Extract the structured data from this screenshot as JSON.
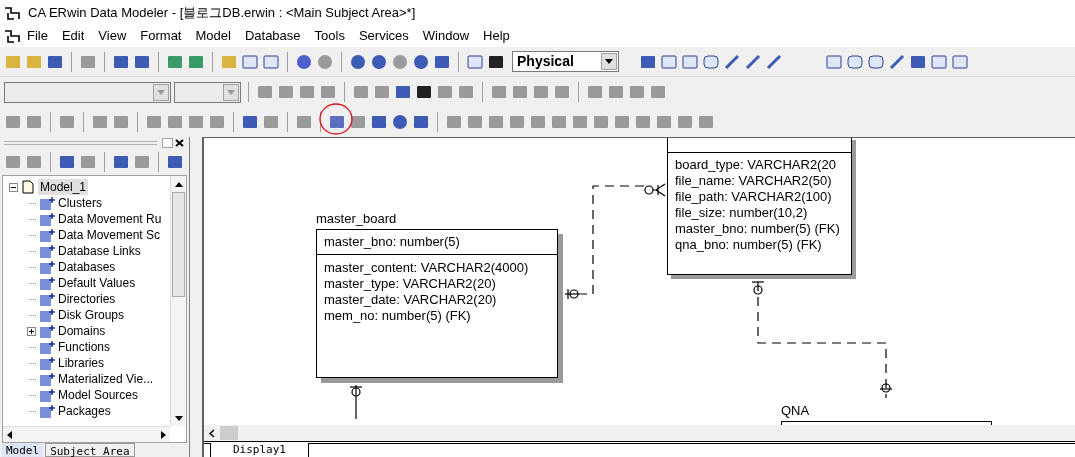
{
  "window": {
    "title": "CA ERwin Data Modeler - [블로그DB.erwin : <Main Subject Area>*]"
  },
  "menu": [
    "File",
    "Edit",
    "View",
    "Format",
    "Model",
    "Database",
    "Tools",
    "Services",
    "Window",
    "Help"
  ],
  "toolbar": {
    "model_type": "Physical"
  },
  "model_tree": {
    "items": [
      {
        "label": "Model_1",
        "expanded": true,
        "selected": true,
        "children": [
          {
            "label": "Clusters",
            "expandable": false,
            "selected": false
          },
          {
            "label": "Data Movement Ru",
            "expandable": false,
            "selected": false
          },
          {
            "label": "Data Movement Sc",
            "expandable": false,
            "selected": false
          },
          {
            "label": "Database Links",
            "expandable": false,
            "selected": false
          },
          {
            "label": "Databases",
            "expandable": false,
            "selected": false
          },
          {
            "label": "Default Values",
            "expandable": false,
            "selected": false
          },
          {
            "label": "Directories",
            "expandable": false,
            "selected": false
          },
          {
            "label": "Disk Groups",
            "expandable": false,
            "selected": false
          },
          {
            "label": "Domains",
            "expandable": true,
            "selected": false
          },
          {
            "label": "Functions",
            "expandable": false,
            "selected": false
          },
          {
            "label": "Libraries",
            "expandable": false,
            "selected": false
          },
          {
            "label": "Materialized Vie...",
            "expandable": false,
            "selected": false
          },
          {
            "label": "Model Sources",
            "expandable": false,
            "selected": false
          },
          {
            "label": "Packages",
            "expandable": false,
            "selected": false
          }
        ]
      }
    ]
  },
  "panel_tabs": [
    {
      "label": "Model",
      "selected": true
    },
    {
      "label": "Subject Area",
      "selected": false
    }
  ],
  "entities": [
    {
      "name": "master_board",
      "keys": [
        "master_bno: number(5)"
      ],
      "attributes": [
        "master_content: VARCHAR2(4000)",
        "master_type: VARCHAR2(20)",
        "master_date: VARCHAR2(20)",
        "mem_no: number(5) (FK)"
      ]
    },
    {
      "attributes": [
        "board_type: VARCHAR2(20",
        "file_name: VARCHAR2(50)",
        "file_path: VARCHAR2(100)",
        "file_size: number(10,2)",
        "master_bno: number(5) (FK)",
        "qna_bno: number(5) (FK)"
      ]
    },
    {
      "name": "QNA"
    }
  ],
  "canvas_tabs": [
    {
      "label": "Display1",
      "selected": true
    }
  ]
}
